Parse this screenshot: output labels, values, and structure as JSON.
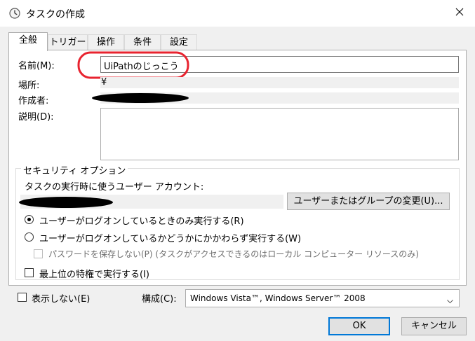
{
  "window": {
    "title": "タスクの作成"
  },
  "tabs": [
    {
      "label": "全般",
      "active": true
    },
    {
      "label": "トリガー"
    },
    {
      "label": "操作"
    },
    {
      "label": "条件"
    },
    {
      "label": "設定"
    }
  ],
  "general": {
    "name_label": "名前(M):",
    "name_value": "UiPathのじっこう",
    "location_label": "場所:",
    "location_value": "¥",
    "author_label": "作成者:",
    "description_label": "説明(D):"
  },
  "security": {
    "group_label": "セキュリティ オプション",
    "account_label": "タスクの実行時に使うユーザー アカウント:",
    "change_button": "ユーザーまたはグループの変更(U)...",
    "radio_logon_only": "ユーザーがログオンしているときのみ実行する(R)",
    "radio_whether": "ユーザーがログオンしているかどうかにかかわらず実行する(W)",
    "no_store_password": "パスワードを保存しない(P) (タスクがアクセスできるのはローカル コンピューター リソースのみ)",
    "highest_privileges": "最上位の特権で実行する(I)"
  },
  "bottom": {
    "hidden_label": "表示しない(E)",
    "configure_label": "構成(C):",
    "configure_value": "Windows Vista™, Windows Server™ 2008"
  },
  "buttons": {
    "ok": "OK",
    "cancel": "キャンセル"
  },
  "colors": {
    "highlight_circle": "#e8232f",
    "default_button_border": "#0078d7"
  }
}
